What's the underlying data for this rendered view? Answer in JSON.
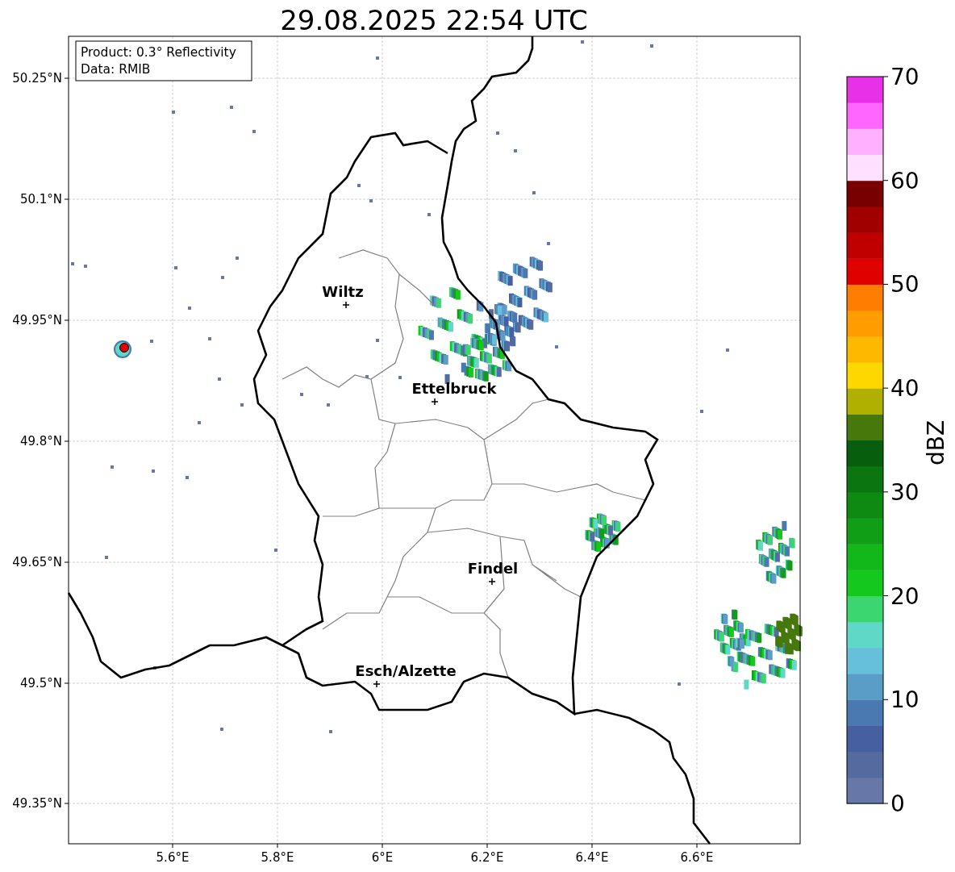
{
  "title": "29.08.2025 22:54 UTC",
  "info_box": [
    "Product: 0.3° Reflectivity",
    "Data: RMIB"
  ],
  "cities": [
    {
      "name": "Wiltz"
    },
    {
      "name": "Ettelbruck"
    },
    {
      "name": "Findel"
    },
    {
      "name": "Esch/Alzette"
    }
  ],
  "lat_ticks": [
    "50.25°N",
    "50.1°N",
    "49.95°N",
    "49.8°N",
    "49.65°N",
    "49.5°N",
    "49.35°N"
  ],
  "lon_ticks": [
    "5.6°E",
    "5.8°E",
    "6°E",
    "6.2°E",
    "6.4°E",
    "6.6°E"
  ],
  "colorbar": {
    "label": "dBZ",
    "ticks": [
      "70",
      "60",
      "50",
      "40",
      "30",
      "20",
      "10",
      "0"
    ],
    "bins": [
      {
        "color": "#6677a8"
      },
      {
        "color": "#556a9f"
      },
      {
        "color": "#465fa0"
      },
      {
        "color": "#4a78b0"
      },
      {
        "color": "#5a9ec8"
      },
      {
        "color": "#66c0dc"
      },
      {
        "color": "#60d8c8"
      },
      {
        "color": "#3cd670"
      },
      {
        "color": "#14c81e"
      },
      {
        "color": "#12b81a"
      },
      {
        "color": "#109e16"
      },
      {
        "color": "#0e8a12"
      },
      {
        "color": "#0b7510"
      },
      {
        "color": "#075e0c"
      },
      {
        "color": "#46780c"
      },
      {
        "color": "#b0b000"
      },
      {
        "color": "#ffd700"
      },
      {
        "color": "#ffb800"
      },
      {
        "color": "#ff9c00"
      },
      {
        "color": "#ff7d00"
      },
      {
        "color": "#e00000"
      },
      {
        "color": "#c00000"
      },
      {
        "color": "#a00000"
      },
      {
        "color": "#780000"
      },
      {
        "color": "#ffe0ff"
      },
      {
        "color": "#ffb0ff"
      },
      {
        "color": "#ff66ff"
      },
      {
        "color": "#e830e8"
      }
    ]
  }
}
